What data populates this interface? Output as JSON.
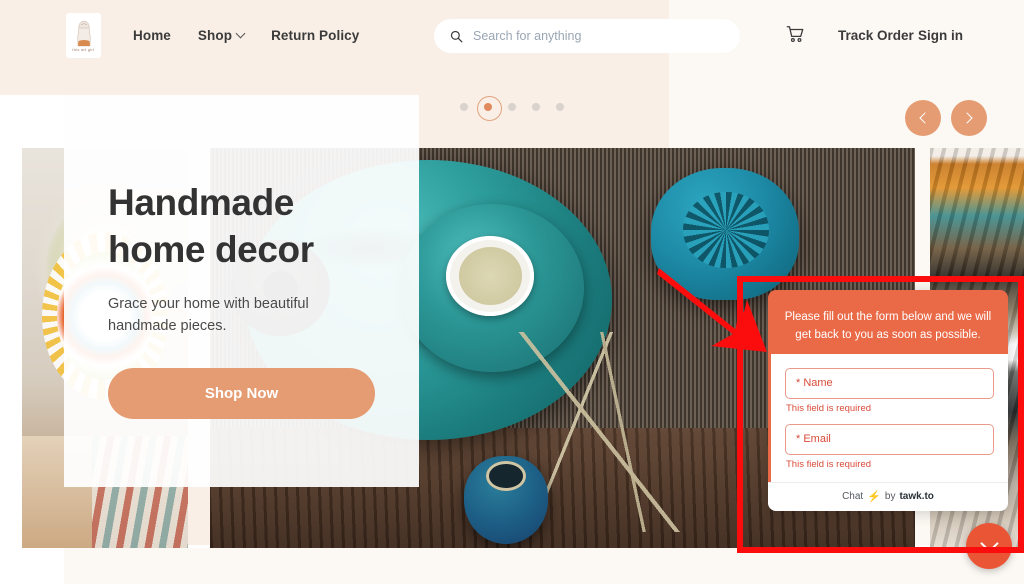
{
  "header": {
    "logo": {
      "name": "logo",
      "caption": "this art girl"
    },
    "nav": [
      {
        "label": "Home",
        "has_dropdown": false
      },
      {
        "label": "Shop",
        "has_dropdown": true
      },
      {
        "label": "Return Policy",
        "has_dropdown": false
      }
    ],
    "search": {
      "placeholder": "Search for anything",
      "value": ""
    },
    "cart_icon": "shopping-cart-icon",
    "track_order": "Track Order",
    "sign_in": "Sign in"
  },
  "carousel": {
    "dot_count": 5,
    "active_index": 1,
    "prev_label": "‹",
    "next_label": "›"
  },
  "hero": {
    "title_line1": "Handmade",
    "title_line2": "home decor",
    "subtitle": "Grace your home with beautiful handmade pieces.",
    "cta": "Shop Now"
  },
  "chat": {
    "prompt": "Please fill out the form below and we will get back to you as soon as possible.",
    "fields": [
      {
        "placeholder": "* Name",
        "value": "",
        "error": "This field is required"
      },
      {
        "placeholder": "* Email",
        "value": "",
        "error": "This field is required"
      }
    ],
    "footer_prefix": "Chat",
    "footer_bolt": "⚡",
    "footer_by": "by",
    "footer_brand": "tawk.to",
    "minimize_icon": "chevron-down-icon"
  },
  "colors": {
    "brand_orange": "#e59c72",
    "chat_orange": "#ea6a47",
    "chat_fab": "#ea5535",
    "error_red": "#d94b3a",
    "annotation_red": "#fb0d0d",
    "page_cream": "#f9efe6",
    "page_cream_light": "#fcf8f3"
  },
  "annotations": {
    "highlight_box": "red-rectangle-around-chat-widget",
    "arrow": "red-arrow-pointing-to-chat-widget"
  }
}
